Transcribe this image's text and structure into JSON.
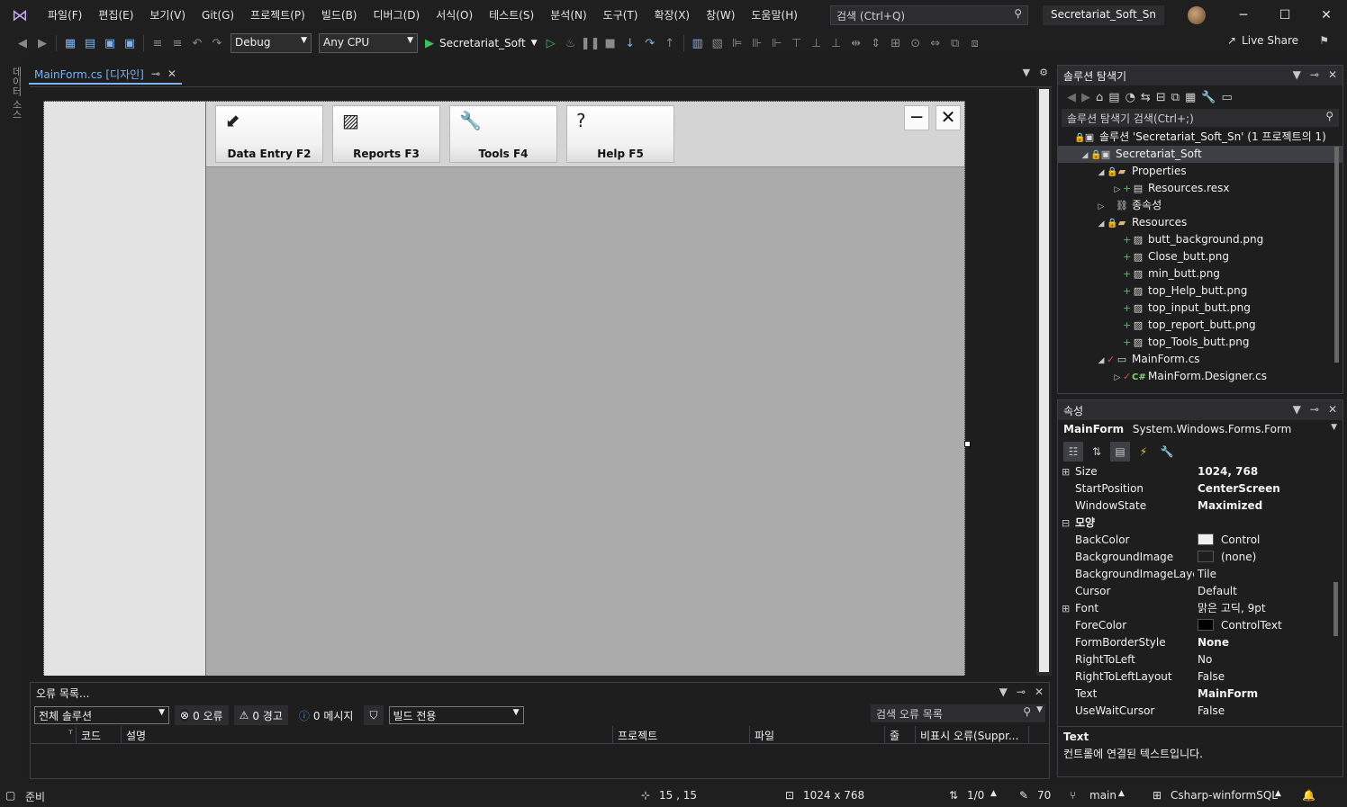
{
  "menu": {
    "logo_icon": "visual-studio-logo-icon",
    "items": [
      "파일(F)",
      "편집(E)",
      "보기(V)",
      "Git(G)",
      "프로젝트(P)",
      "빌드(B)",
      "디버그(D)",
      "서식(O)",
      "테스트(S)",
      "분석(N)",
      "도구(T)",
      "확장(X)",
      "창(W)",
      "도움말(H)"
    ],
    "search_placeholder": "검색 (Ctrl+Q)",
    "solution_name": "Secretariat_Soft_Sn"
  },
  "toolbar": {
    "config": "Debug",
    "platform": "Any CPU",
    "run_target": "Secretariat_Soft",
    "live_share": "Live Share"
  },
  "left_strip": {
    "label": "데이터 소스"
  },
  "document": {
    "tab_title": "MainForm.cs [디자인]",
    "pin_glyph": "⊸",
    "close_glyph": "✕"
  },
  "designer": {
    "buttons": [
      {
        "label": "Data Entry F2",
        "icon": "data-entry-icon"
      },
      {
        "label": "Reports F3",
        "icon": "reports-icon"
      },
      {
        "label": "Tools F4",
        "icon": "wrench-icon"
      },
      {
        "label": "Help F5",
        "icon": "help-icon"
      }
    ]
  },
  "solution_explorer": {
    "title": "솔루션 탐색기",
    "search_placeholder": "솔루션 탐색기 검색(Ctrl+;)",
    "tree": [
      {
        "text": "솔루션 'Secretariat_Soft_Sn' (1 프로젝트의 1)",
        "indent": 0
      },
      {
        "text": "Secretariat_Soft",
        "indent": 1,
        "selected": true
      },
      {
        "text": "Properties",
        "indent": 2
      },
      {
        "text": "Resources.resx",
        "indent": 3
      },
      {
        "text": "종속성",
        "indent": 2
      },
      {
        "text": "Resources",
        "indent": 2
      },
      {
        "text": "butt_background.png",
        "indent": 3
      },
      {
        "text": "Close_butt.png",
        "indent": 3
      },
      {
        "text": "min_butt.png",
        "indent": 3
      },
      {
        "text": "top_Help_butt.png",
        "indent": 3
      },
      {
        "text": "top_input_butt.png",
        "indent": 3
      },
      {
        "text": "top_report_butt.png",
        "indent": 3
      },
      {
        "text": "top_Tools_butt.png",
        "indent": 3
      },
      {
        "text": "MainForm.cs",
        "indent": 2
      },
      {
        "text": "MainForm.Designer.cs",
        "indent": 3
      }
    ]
  },
  "properties": {
    "title": "속성",
    "object_name": "MainForm",
    "object_type": "System.Windows.Forms.Form",
    "rows": [
      {
        "name": "Size",
        "value": "1024, 768",
        "bold": true,
        "expand": true
      },
      {
        "name": "StartPosition",
        "value": "CenterScreen",
        "bold": true
      },
      {
        "name": "WindowState",
        "value": "Maximized",
        "bold": true
      },
      {
        "name": "모양",
        "value": "",
        "category": true
      },
      {
        "name": "BackColor",
        "value": "Control",
        "swatch": "#f0f0f0"
      },
      {
        "name": "BackgroundImage",
        "value": "(none)",
        "swatch": "#1e1e1e"
      },
      {
        "name": "BackgroundImageLayout",
        "value": "Tile"
      },
      {
        "name": "Cursor",
        "value": "Default"
      },
      {
        "name": "Font",
        "value": "맑은 고딕, 9pt",
        "expand": true
      },
      {
        "name": "ForeColor",
        "value": "ControlText",
        "swatch": "#000000"
      },
      {
        "name": "FormBorderStyle",
        "value": "None",
        "bold": true
      },
      {
        "name": "RightToLeft",
        "value": "No"
      },
      {
        "name": "RightToLeftLayout",
        "value": "False"
      },
      {
        "name": "Text",
        "value": "MainForm",
        "bold": true
      },
      {
        "name": "UseWaitCursor",
        "value": "False"
      }
    ],
    "desc_title": "Text",
    "desc_text": "컨트롤에 연결된 텍스트입니다."
  },
  "error_list": {
    "title": "오류 목록...",
    "scope": "전체 솔루션",
    "errors": "0 오류",
    "warnings": "0 경고",
    "messages": "0 메시지",
    "build_filter": "빌드 전용",
    "search_placeholder": "검색 오류 목록",
    "columns": [
      "코드",
      "설명",
      "프로젝트",
      "파일",
      "줄",
      "비표시 오류(Suppr..."
    ]
  },
  "status": {
    "ready": "준비",
    "position": "15 , 15",
    "size": "1024 x 768",
    "changes": "1/0",
    "pencil": "70",
    "branch": "main",
    "repo": "Csharp-winformSQL"
  }
}
